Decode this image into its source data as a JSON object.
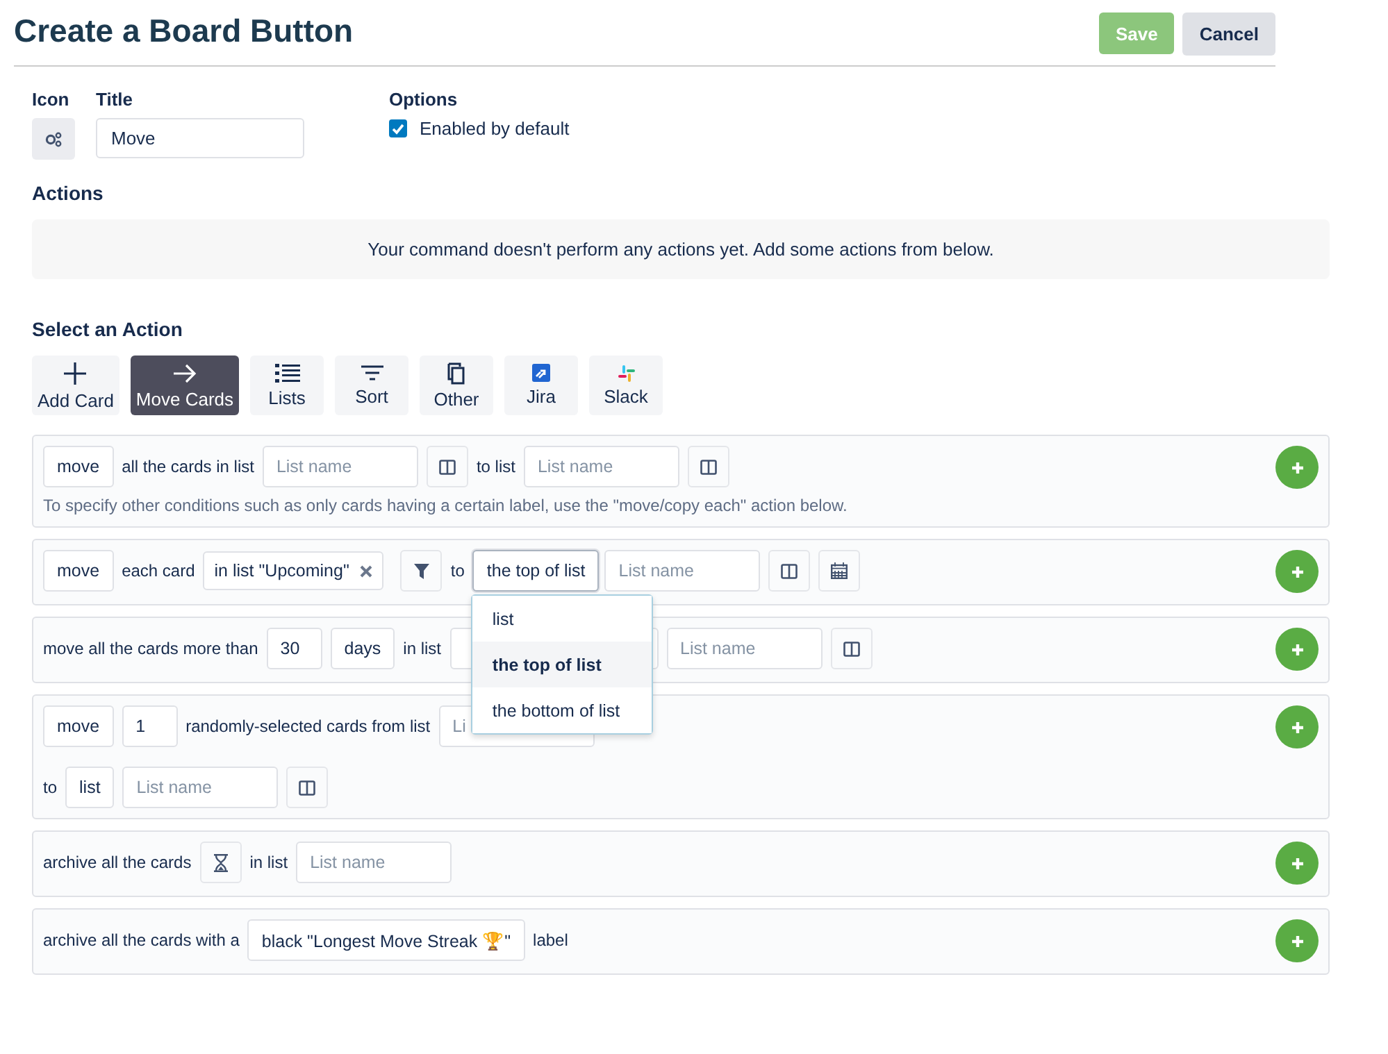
{
  "header": {
    "title": "Create a Board Button",
    "buttons": [
      {
        "label": "Save",
        "kind": "primary",
        "disabled": true
      },
      {
        "label": "Cancel",
        "kind": "secondary",
        "disabled": false
      }
    ]
  },
  "form": {
    "icon_label": "Icon",
    "title_label": "Title",
    "title_value": "Move",
    "options_label": "Options",
    "options": [
      {
        "label": "Enabled by default",
        "checked": true
      }
    ]
  },
  "actions": {
    "heading": "Actions",
    "empty_message": "Your command doesn't perform any actions yet. Add some actions from below."
  },
  "select_action": {
    "heading": "Select an Action",
    "tabs": [
      {
        "label": "Add Card",
        "selected": false
      },
      {
        "label": "Move Cards",
        "selected": true
      },
      {
        "label": "Lists",
        "selected": false
      },
      {
        "label": "Sort",
        "selected": false
      },
      {
        "label": "Other",
        "selected": false
      },
      {
        "label": "Jira",
        "selected": false
      },
      {
        "label": "Slack",
        "selected": false
      }
    ]
  },
  "action_rows": [
    {
      "parts": [
        {
          "kind": "select",
          "text": "move"
        },
        {
          "kind": "text",
          "text": "all the cards in list"
        },
        {
          "kind": "input",
          "placeholder": "List name"
        },
        {
          "kind": "columns"
        },
        {
          "kind": "text",
          "text": "to list"
        },
        {
          "kind": "input",
          "placeholder": "List name"
        },
        {
          "kind": "columns"
        },
        {
          "kind": "note",
          "text": "To specify other conditions such as only cards having a certain label, use the \"move/copy each\" action below."
        }
      ]
    },
    {
      "parts": [
        {
          "kind": "select",
          "text": "move"
        },
        {
          "kind": "text",
          "text": "each card"
        },
        {
          "kind": "chip",
          "text": "in list \"Upcoming\""
        },
        {
          "kind": "filter"
        },
        {
          "kind": "text",
          "text": "to"
        },
        {
          "kind": "select",
          "text": "the top of list",
          "open": true,
          "options": [
            {
              "label": "list",
              "selected": false
            },
            {
              "label": "the top of list",
              "selected": true
            },
            {
              "label": "the bottom of list",
              "selected": false
            }
          ]
        },
        {
          "kind": "input",
          "placeholder": "List name"
        },
        {
          "kind": "columns"
        },
        {
          "kind": "calendar"
        }
      ]
    },
    {
      "parts": [
        {
          "kind": "text",
          "text": "move all the cards more than"
        },
        {
          "kind": "input",
          "value": "30"
        },
        {
          "kind": "select",
          "text": "days"
        },
        {
          "kind": "text",
          "text": "in list"
        },
        {
          "kind": "input"
        },
        {
          "kind": "input",
          "placeholder": "List name"
        },
        {
          "kind": "columns"
        }
      ]
    },
    {
      "parts": [
        {
          "kind": "select",
          "text": "move"
        },
        {
          "kind": "input",
          "value": "1"
        },
        {
          "kind": "text",
          "text": "randomly-selected cards from list"
        },
        {
          "kind": "input",
          "placeholder": "Li"
        },
        {
          "kind": "break"
        },
        {
          "kind": "text",
          "text": "to"
        },
        {
          "kind": "select",
          "text": "list"
        },
        {
          "kind": "input",
          "placeholder": "List name"
        },
        {
          "kind": "columns"
        }
      ]
    },
    {
      "parts": [
        {
          "kind": "text",
          "text": "archive all the cards"
        },
        {
          "kind": "hourglass"
        },
        {
          "kind": "text",
          "text": "in list"
        },
        {
          "kind": "input",
          "placeholder": "List name"
        }
      ]
    },
    {
      "parts": [
        {
          "kind": "text",
          "text": "archive all the cards with a"
        },
        {
          "kind": "select",
          "text": "black \"Longest Move Streak 🏆\""
        },
        {
          "kind": "text",
          "text": "label"
        }
      ]
    }
  ]
}
